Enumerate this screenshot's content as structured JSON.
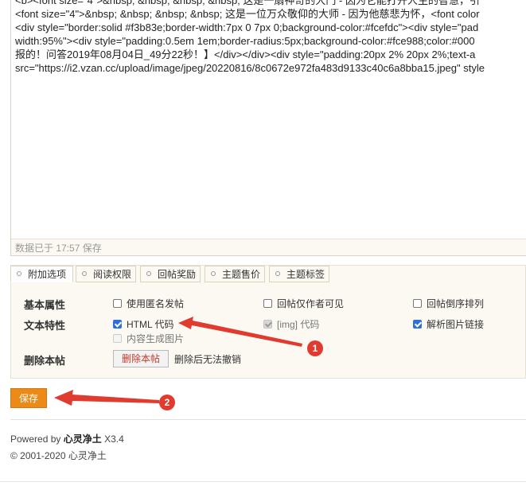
{
  "editor": {
    "lines": [
      "<b><font size=\"4\">&nbsp; &nbsp; &nbsp; &nbsp; 这是一扇神奇的大门 - 因为它能打开人生的智慧，引",
      "<font size=\"4\">&nbsp; &nbsp; &nbsp; &nbsp; 这是一位万众敬仰的大师 - 因为他慈悲为怀，<font color",
      "<div style=\"border:solid #f3b83e;border-width:7px 0 7px 0;background-color:#fcefdc\"><div style=\"pad",
      "width:95%\"><div style=\"padding:0.5em 1em;border-radius:5px;background-color:#fce988;color:#000",
      "报的！问答2019年08月04日_49分22秒！】</div></div><div style=\"padding:20px 2% 20px 2%;text-a",
      "src=\"https://i2.vzan.cc/upload/image/jpeg/20220816/8c0672e972fa483d9133c40c6a8bba15.jpeg\" style"
    ],
    "saved_status": "数据已于 17:57 保存"
  },
  "tabs": [
    {
      "label": "附加选项",
      "active": true
    },
    {
      "label": "阅读权限",
      "active": false
    },
    {
      "label": "回帖奖励",
      "active": false
    },
    {
      "label": "主题售价",
      "active": false
    },
    {
      "label": "主题标签",
      "active": false
    }
  ],
  "options": {
    "basic_label": "基本属性",
    "anonymous": {
      "label": "使用匿名发帖",
      "checked": false
    },
    "reply_author_only": {
      "label": "回帖仅作者可见",
      "checked": false
    },
    "reverse_replies": {
      "label": "回帖倒序排列",
      "checked": false
    },
    "text_label": "文本特性",
    "html_code": {
      "label": "HTML 代码",
      "checked": true
    },
    "img_code": {
      "label": "[img] 代码",
      "checked": true,
      "disabled": true
    },
    "parse_image_links": {
      "label": "解析图片链接",
      "checked": true
    },
    "content_to_image": {
      "label": "内容生成图片",
      "checked": false,
      "disabled": true
    },
    "delete_label": "删除本帖",
    "delete_button": "删除本帖",
    "delete_note": "删除后无法撤销"
  },
  "save_button": "保存",
  "annotations": {
    "badge1": "1",
    "badge2": "2",
    "color": "#e13b30"
  },
  "footer": {
    "powered_prefix": "Powered by",
    "brand": "心灵净土",
    "version": "X3.4",
    "copyright": "© 2001-2020 心灵净土"
  }
}
